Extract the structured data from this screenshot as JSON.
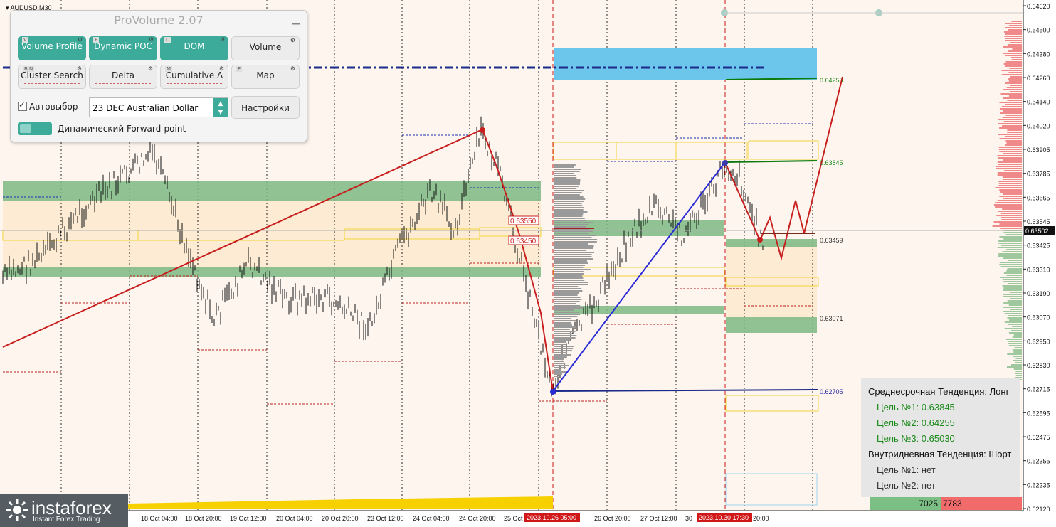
{
  "symbol": "AUDUSD,M30",
  "panel": {
    "title": "ProVolume 2.07",
    "buttons": [
      {
        "key": "V",
        "label": "Volume Profile",
        "active": true
      },
      {
        "key": "P",
        "label": "Dynamic POC",
        "active": true
      },
      {
        "key": "D",
        "label": "DOM",
        "active": true
      },
      {
        "key": "",
        "label": "Volume",
        "active": false
      },
      {
        "key": "B N",
        "label": "Cluster Search",
        "active": false
      },
      {
        "key": "",
        "label": "Delta",
        "active": false
      },
      {
        "key": "M",
        "label": "Cumulative Δ",
        "active": false
      },
      {
        "key": "F",
        "label": "Map",
        "active": false
      }
    ],
    "auto_label": "Автовыбор",
    "instrument": "23 DEC Australian Dollar",
    "settings_label": "Настройки",
    "forward_label": "Динамический Forward-point"
  },
  "price_axis": {
    "labels": [
      "0.64620",
      "0.64500",
      "0.64380",
      "0.64260",
      "0.64140",
      "0.64020",
      "0.63905",
      "0.63785",
      "0.63665",
      "0.63545",
      "0.63425",
      "0.63310",
      "0.63190",
      "0.63070",
      "0.62950",
      "0.62830",
      "0.62715",
      "0.62595",
      "0.62475",
      "0.62355",
      "0.62235",
      "0.62120"
    ],
    "current": "0.63502"
  },
  "time_axis": [
    "18 Oct 04:00",
    "18 Oct 20:00",
    "19 Oct 12:00",
    "20 Oct 04:00",
    "20 Oct 20:00",
    "23 Oct 12:00",
    "24 Oct 04:00",
    "24 Oct 20:00",
    "25 Oct",
    "26 Oct 20:00",
    "27 Oct 12:00",
    "30",
    "20:00"
  ],
  "time_markers": [
    "2023.10.26 05:00",
    "2023.10.30 17:30"
  ],
  "level_labels": [
    "0.64255",
    "0.63845",
    "0.63459",
    "0.63071",
    "0.62705"
  ],
  "red_labels": [
    "0.63550",
    "0.63450"
  ],
  "info": {
    "mid_trend": "Среднесрочная Тенденция: Лонг",
    "targets": [
      "Цель №1: 0.63845",
      "Цель №2: 0.64255",
      "Цель №3: 0.65030"
    ],
    "intra_trend": "Внутридневная Тенденция: Шорт",
    "intra_targets": [
      "Цель №1: нет",
      "Цель №2: нет"
    ]
  },
  "volume_bar": {
    "buy": "7025",
    "sell": "7783"
  },
  "logo": {
    "name": "instaforex",
    "tagline": "Instant Forex Trading"
  },
  "colors": {
    "up_trend": "#c81e1e",
    "blue_trend": "#2b2bd6",
    "green_zone": "#7db984",
    "blue_zone": "#6cc6ec",
    "yellow": "#f2d43a"
  }
}
